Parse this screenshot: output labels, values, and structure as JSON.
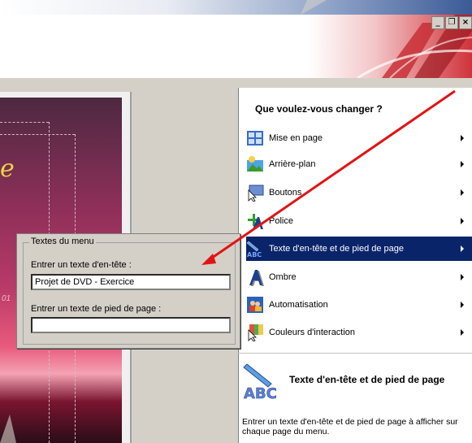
{
  "window": {
    "controls": {
      "minimize": "_",
      "maximize": "❐",
      "close": "×"
    }
  },
  "panel": {
    "title": "Que voulez-vous changer ?",
    "items": [
      {
        "label": "Mise en page",
        "icon": "layout-grid-icon"
      },
      {
        "label": "Arrière-plan",
        "icon": "background-image-icon"
      },
      {
        "label": "Boutons",
        "icon": "buttons-cursor-icon"
      },
      {
        "label": "Police",
        "icon": "font-icon"
      },
      {
        "label": "Texte d'en-tête et de pied de page",
        "icon": "abc-pencil-icon",
        "selected": true
      },
      {
        "label": "Ombre",
        "icon": "shadow-a-icon"
      },
      {
        "label": "Automatisation",
        "icon": "automation-people-icon"
      },
      {
        "label": "Couleurs d'interaction",
        "icon": "color-cursor-icon"
      }
    ],
    "description": {
      "title": "Texte d'en-tête et de pied de page",
      "text": "Entrer un texte d'en-tête et de pied de page à afficher sur chaque page du menu."
    }
  },
  "dialog": {
    "group_label": "Textes du menu",
    "header_label": "Entrer un texte d'en-tête :",
    "header_value": "Projet de DVD - Exercice",
    "footer_label": "Entrer un texte de pied de page :",
    "footer_value": ""
  },
  "preview": {
    "visible_glyph": "e",
    "side_text": "01"
  },
  "colors": {
    "selection": "#0a246a",
    "annotation_arrow": "#e11414"
  }
}
